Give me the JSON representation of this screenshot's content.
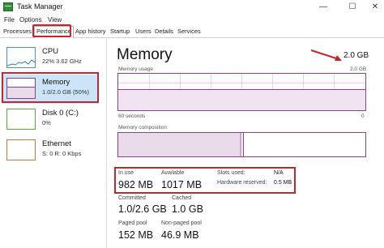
{
  "window": {
    "title": "Task Manager",
    "minimize": "—",
    "maximize": "☐",
    "close": "✕"
  },
  "menu": {
    "file": "File",
    "options": "Options",
    "view": "View"
  },
  "tabs": [
    "Processes",
    "Performance",
    "App history",
    "Startup",
    "Users",
    "Details",
    "Services"
  ],
  "sidebar": {
    "items": [
      {
        "name": "CPU",
        "sub": "22% 3.62 GHz"
      },
      {
        "name": "Memory",
        "sub": "1.0/2.0 GB (50%)"
      },
      {
        "name": "Disk 0 (C:)",
        "sub": "0%"
      },
      {
        "name": "Ethernet",
        "sub": "S: 0 R: 0 Kbps"
      }
    ]
  },
  "memory": {
    "title": "Memory",
    "capacity": "2.0 GB",
    "usage_label": "Memory usage",
    "usage_max": "2.0 GB",
    "time_left": "60 seconds",
    "time_right": "0",
    "composition_label": "Memory composition",
    "in_use_label": "In use",
    "in_use": "982 MB",
    "available_label": "Available",
    "available": "1017 MB",
    "slots_used_label": "Slots used:",
    "slots_used": "N/A",
    "hw_reserved_label": "Hardware reserved:",
    "hw_reserved": "0.5 MB",
    "committed_label": "Committed",
    "committed": "1.0/2.6 GB",
    "cached_label": "Cached",
    "cached": "1.0 GB",
    "paged_label": "Paged pool",
    "paged": "152 MB",
    "nonpaged_label": "Non-paged pool",
    "nonpaged": "46.9 MB"
  },
  "colors": {
    "accent": "#8b3f8f",
    "highlight": "#c0282f",
    "selected": "#cce4f7"
  }
}
